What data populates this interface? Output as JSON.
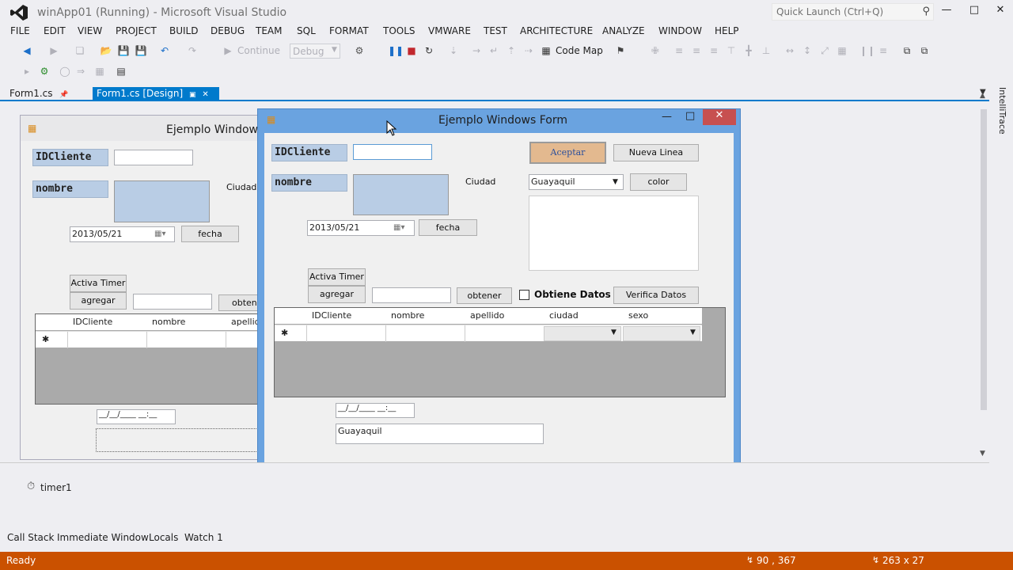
{
  "window": {
    "title": "winApp01 (Running) - Microsoft Visual Studio",
    "quick_launch_placeholder": "Quick Launch (Ctrl+Q)",
    "minimize": "—",
    "maximize": "□",
    "close": "✕"
  },
  "menu": [
    "FILE",
    "EDIT",
    "VIEW",
    "PROJECT",
    "BUILD",
    "DEBUG",
    "TEAM",
    "SQL",
    "FORMAT",
    "TOOLS",
    "VMWARE",
    "TEST",
    "ARCHITECTURE",
    "ANALYZE",
    "WINDOW",
    "HELP"
  ],
  "toolbar": {
    "continue_label": "Continue",
    "config_value": "Debug",
    "code_map_label": "Code Map"
  },
  "tabs": {
    "tab1": "Form1.cs",
    "tab2": "Form1.cs [Design]",
    "side_label": "IntelliTrace"
  },
  "design_form": {
    "title": "Ejemplo Windows",
    "lbl_id": "IDCliente",
    "lbl_nombre": "nombre",
    "lbl_ciudad": "Ciudad",
    "date_value": "2013/05/21",
    "btn_fecha": "fecha",
    "btn_timer": "Activa Timer",
    "btn_agregar": "agregar",
    "btn_obtener": "obtene",
    "grid_cols": [
      "IDCliente",
      "nombre",
      "apellido"
    ],
    "grid_newrow": "✱",
    "masked_value": "__/__/____ __:__"
  },
  "run_form": {
    "title": "Ejemplo Windows Form",
    "lbl_id": "IDCliente",
    "lbl_nombre": "nombre",
    "lbl_ciudad": "Ciudad",
    "btn_aceptar": "Aceptar",
    "btn_nueva": "Nueva Linea",
    "city_selected": "Guayaquil",
    "btn_color": "color",
    "date_value": "2013/05/21",
    "btn_fecha": "fecha",
    "btn_timer": "Activa Timer",
    "btn_agregar": "agregar",
    "btn_obtener": "obtener",
    "chk_label": "Obtiene Datos",
    "btn_verifica": "Verifica Datos",
    "grid_cols": [
      "IDCliente",
      "nombre",
      "apellido",
      "ciudad",
      "sexo"
    ],
    "grid_newrow": "✱",
    "masked_value": "__/__/____ __:__",
    "city_text": "Guayaquil"
  },
  "tray": {
    "timer_label": "timer1"
  },
  "bottom_tabs": [
    "Call Stack",
    "Immediate Window",
    "Locals",
    "Watch 1"
  ],
  "status": {
    "text": "Ready",
    "position": "90 , 367",
    "size": "263 x 27"
  },
  "colors": {
    "accent": "#007acc",
    "status": "#ca5100",
    "label_bg": "#b9cde5",
    "aceptar_bg": "#e3b98f"
  }
}
